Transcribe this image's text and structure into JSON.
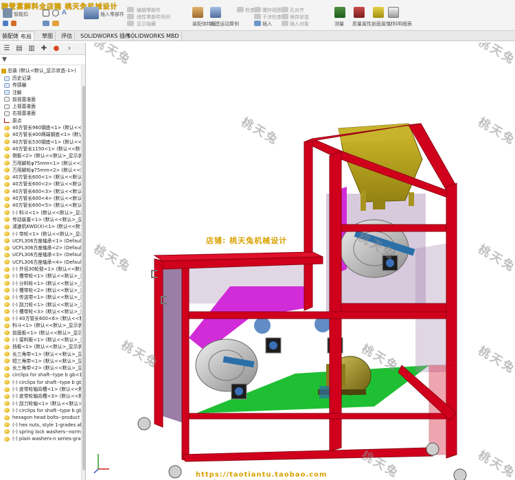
{
  "window": {
    "title": "跨登宴解料全店箱  桃天兔机械设计"
  },
  "ribbon": {
    "groups": [
      {
        "label": "智能扣件"
      },
      {
        "label": "插入零部件"
      },
      {
        "label": "配合"
      },
      {
        "label": "线性零部件阵列"
      },
      {
        "label": "编辑零部件"
      },
      {
        "label": "显示隐藏零部件"
      },
      {
        "label": "装配体特征"
      },
      {
        "label": "参考几何体"
      },
      {
        "label": "新建运动算例"
      },
      {
        "label": "材料明细表"
      },
      {
        "label": "爆炸视图"
      },
      {
        "label": "爆炸直线草图"
      },
      {
        "label": "干涉检查"
      },
      {
        "label": "间隙验证"
      },
      {
        "label": "孔对齐"
      },
      {
        "label": "测量"
      },
      {
        "label": "质量属性"
      },
      {
        "label": "剖面属性"
      },
      {
        "label": "插入对象"
      },
      {
        "label": "保存状态"
      },
      {
        "label": "渲染工具"
      }
    ],
    "visible_labels": {
      "smart_fastener": "智能扣",
      "insert_components": "插入零部件",
      "assembly_features": "装配体特征",
      "insert": "插入",
      "measure": "测量",
      "mass_props": "质量属性",
      "section_props": "剖面属性",
      "bom": "材料明细表",
      "tools_col1_a": "编辑零部件",
      "tools_col1_b": "线性零部件阵列",
      "tools_col1_c": "显示隐藏",
      "tools_col2_a": "新建运动算例",
      "tools_col2_b": "检查",
      "tools_col3_a": "爆炸视图",
      "tools_col3_b": "干涉检查",
      "tools_col3_c": "间隙验证",
      "tools_col4_a": "孔对齐",
      "tools_col4_b": "保存状态",
      "tools_col4_c": "插入对象"
    }
  },
  "tabs": [
    {
      "label": "装配体",
      "active": false
    },
    {
      "label": "布局",
      "active": true
    },
    {
      "label": "草图",
      "active": false
    },
    {
      "label": "评估",
      "active": false
    },
    {
      "label": "SOLIDWORKS 插件",
      "active": false
    },
    {
      "label": "SOLIDWORKS MBD",
      "active": false
    }
  ],
  "feature_tree": {
    "root": "总装 (默认<默认_显示状态-1>)",
    "items": [
      {
        "label": "历史记录",
        "kind": "feat"
      },
      {
        "label": "传感器",
        "kind": "feat"
      },
      {
        "label": "注解",
        "kind": "feat"
      },
      {
        "label": "前视基准面",
        "kind": "plane"
      },
      {
        "label": "上视基准面",
        "kind": "plane"
      },
      {
        "label": "右视基准面",
        "kind": "plane"
      },
      {
        "label": "原点",
        "kind": "origin"
      },
      {
        "label": "40方管长960钢底<1> (默认<<默认",
        "kind": "part"
      },
      {
        "label": "40方管长400两端钢底<1> (默认<<默",
        "kind": "part"
      },
      {
        "label": "40方管长530钢底<1> (默认<<默认",
        "kind": "part"
      },
      {
        "label": "40方管长1150<1> (默认<<默认>_显",
        "kind": "part"
      },
      {
        "label": "侧板<2> (默认<<默认>_显示状态",
        "kind": "part"
      },
      {
        "label": "万用脚轮φ75mm<1> (默认<<默认",
        "kind": "part"
      },
      {
        "label": "万用脚轮φ75mm<2> (默认<<默认",
        "kind": "part"
      },
      {
        "label": "40方管长600<1> (默认<<默认>_显",
        "kind": "part"
      },
      {
        "label": "40方管长600<2> (默认<<默认>_显",
        "kind": "part"
      },
      {
        "label": "40方管长600<3> (默认<<默认>_显",
        "kind": "part"
      },
      {
        "label": "40方管长600<4> (默认<<默认>_显",
        "kind": "part"
      },
      {
        "label": "40方管长600<5> (默认<<默认>_显",
        "kind": "part"
      },
      {
        "label": "(-) 料斗<1> (默认<<默认>_显示状",
        "kind": "part"
      },
      {
        "label": "传动装置<1> (默认<<默认>_显示状",
        "kind": "part"
      },
      {
        "label": "减速机KWD(X)<1> (默认<<默认",
        "kind": "part"
      },
      {
        "label": "(-) 带轮<1> (默认<<默认>_显示状",
        "kind": "part"
      },
      {
        "label": "UCFL306方座轴承<1> (Default<<",
        "kind": "part"
      },
      {
        "label": "UCFL306方座轴承<2> (Default<<",
        "kind": "part"
      },
      {
        "label": "UCFL306方座轴承<3> (Default<<",
        "kind": "part"
      },
      {
        "label": "UCFL306方座轴承<4> (Default<<",
        "kind": "part"
      },
      {
        "label": "(-) 外径30轮毂<1> (默认<<默认>_",
        "kind": "part"
      },
      {
        "label": "(-) 槽带轮<1> (默认<<默认>_显示",
        "kind": "part"
      },
      {
        "label": "(-) 分料轮<1> (默认<<默认>_显示",
        "kind": "part"
      },
      {
        "label": "(-) 槽带轮<2> (默认<<默认>_显示",
        "kind": "part"
      },
      {
        "label": "(-) 传送带<1> (默认<<默认>_显示",
        "kind": "part"
      },
      {
        "label": "(-) 刮刀轮<1> (默认<<默认>_显示",
        "kind": "part"
      },
      {
        "label": "(-) 槽带轮<3> (默认<<默认>_显示",
        "kind": "part"
      },
      {
        "label": "(-) 40方管长600<6> (默认<<默认",
        "kind": "part"
      },
      {
        "label": "料斗<1> (默认<<默认>_显示状态",
        "kind": "part"
      },
      {
        "label": "前面板<1> (默认<<默认>_显示状态",
        "kind": "part"
      },
      {
        "label": "(-) 接料板<1> (默认<<默认>_显示",
        "kind": "part"
      },
      {
        "label": "挡板<1> (默认<<默认>_显示状态",
        "kind": "part"
      },
      {
        "label": "长三角带<1> (默认<<默认>_显示",
        "kind": "part"
      },
      {
        "label": "短三角带<1> (默认<<默认>_显示",
        "kind": "part"
      },
      {
        "label": "长三角带<2> (默认<<默认>_显示",
        "kind": "part"
      },
      {
        "label": "circlips for shaft--type b gb<1>",
        "kind": "part"
      },
      {
        "label": "(-) circlips for shaft--type b gb-",
        "kind": "part"
      },
      {
        "label": "(-) 皮带轮轴向槽<1> (默认<<默认",
        "kind": "part"
      },
      {
        "label": "(-) 皮带轮轴向槽<3> (默认<<默认",
        "kind": "part"
      },
      {
        "label": "(-) 刮刀轮轴<1> (默认<<默认>_显",
        "kind": "part"
      },
      {
        "label": "(-) circlips for shaft--type b gb<",
        "kind": "part"
      },
      {
        "label": "hexagon head bolts--product g",
        "kind": "part"
      },
      {
        "label": "(-) hex nuts, style 1-grades ab g",
        "kind": "part"
      },
      {
        "label": "(-) spring lock washers--norma",
        "kind": "part"
      },
      {
        "label": "(-) plain washers-n series-grad",
        "kind": "part"
      }
    ]
  },
  "viewport": {
    "shop_label": "店铺:  桃天兔机械设计",
    "url_label": "https://taotiantu.taobao.com",
    "watermark": "桃天兔"
  },
  "colors": {
    "frame_red": "#d0001c",
    "frame_red_dark": "#8e0012",
    "hopper_olive": "#b8a21c",
    "chute_magenta": "#d22bd8",
    "panel_violet": "#9a7ea6",
    "floor_green": "#1fbf33",
    "pulley_gray": "#c2c2c2",
    "bearing_blue": "#3a6fb8",
    "motor_olive": "#8d7d1d",
    "brand_yellow": "#d9a100"
  }
}
